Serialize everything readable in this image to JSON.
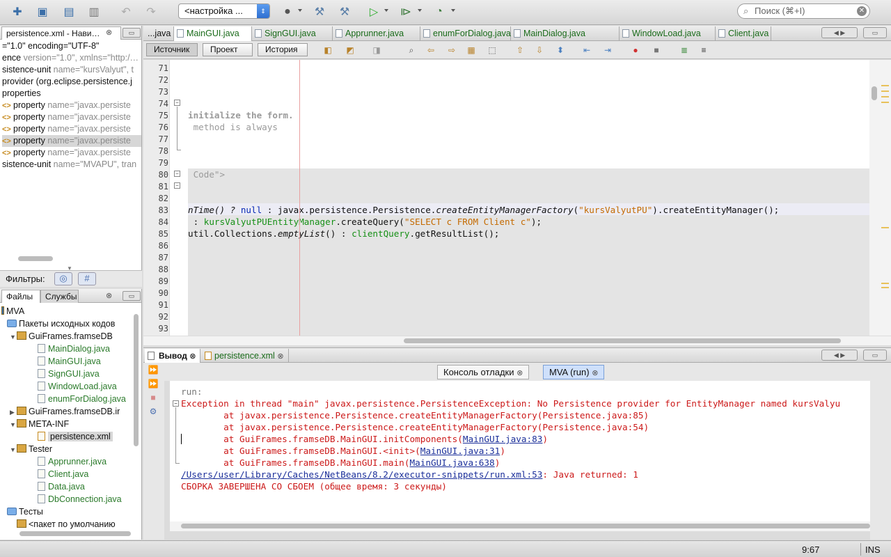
{
  "toolbar": {
    "config_value": "<настройка ...",
    "search_placeholder": "Поиск (⌘+I)",
    "icons": [
      "new-file-icon",
      "new-project-icon",
      "open-project-icon",
      "close-project-icon",
      "undo-icon",
      "redo-icon",
      "globe-icon",
      "build-icon",
      "clean-build-icon",
      "run-icon",
      "debug-icon",
      "profile-icon"
    ]
  },
  "nav": {
    "tab_label": "persistence.xml - Нави…",
    "lines": [
      {
        "text": "=\"1.0\" encoding=\"UTF-8\"",
        "attr": ""
      },
      {
        "text": "ence ",
        "attr": "version=\"1.0\", xmlns=\"http:/…"
      },
      {
        "text": "sistence-unit ",
        "attr": "name=\"kursValyut\", t"
      },
      {
        "text": "provider (org.eclipse.persistence.j",
        "attr": ""
      },
      {
        "text": "properties",
        "attr": ""
      },
      {
        "text": "property ",
        "attr": "name=\"javax.persiste"
      },
      {
        "text": "property ",
        "attr": "name=\"javax.persiste"
      },
      {
        "text": "property ",
        "attr": "name=\"javax.persiste"
      },
      {
        "text": "property ",
        "attr": "name=\"javax.persiste"
      },
      {
        "text": "property ",
        "attr": "name=\"javax.persiste"
      },
      {
        "text": "sistence-unit ",
        "attr": "name=\"MVAPU\", tran"
      }
    ],
    "filters_label": "Фильтры:"
  },
  "files": {
    "tabs": [
      "Файлы",
      "Службы"
    ],
    "tree": [
      {
        "label": "MVA",
        "indent": 0,
        "type": "project"
      },
      {
        "label": "Пакеты исходных кодов",
        "indent": 1,
        "type": "folder"
      },
      {
        "label": "GuiFrames.framseDB",
        "indent": 2,
        "type": "pkg"
      },
      {
        "label": "MainDialog.java",
        "indent": 3,
        "type": "java"
      },
      {
        "label": "MainGUI.java",
        "indent": 3,
        "type": "java"
      },
      {
        "label": "SignGUI.java",
        "indent": 3,
        "type": "java"
      },
      {
        "label": "WindowLoad.java",
        "indent": 3,
        "type": "java"
      },
      {
        "label": "enumForDialog.java",
        "indent": 3,
        "type": "java"
      },
      {
        "label": "GuiFrames.framseDB.ir",
        "indent": 2,
        "type": "pkg"
      },
      {
        "label": "META-INF",
        "indent": 2,
        "type": "pkg"
      },
      {
        "label": "persistence.xml",
        "indent": 3,
        "type": "xml"
      },
      {
        "label": "Tester",
        "indent": 2,
        "type": "pkg"
      },
      {
        "label": "Apprunner.java",
        "indent": 3,
        "type": "java"
      },
      {
        "label": "Client.java",
        "indent": 3,
        "type": "java"
      },
      {
        "label": "Data.java",
        "indent": 3,
        "type": "java"
      },
      {
        "label": "DbConnection.java",
        "indent": 3,
        "type": "java"
      },
      {
        "label": "Тесты",
        "indent": 1,
        "type": "folder"
      },
      {
        "label": "<пакет по умолчанию",
        "indent": 2,
        "type": "pkg"
      }
    ]
  },
  "editor": {
    "tabs": [
      "...java",
      "MainGUI.java",
      "SignGUI.java",
      "Apprunner.java",
      "enumForDialog.java",
      "MainDialog.java",
      "WindowLoad.java",
      "Client.java"
    ],
    "view_buttons": [
      "Источник",
      "Проект",
      "История"
    ],
    "line_numbers": [
      "71",
      "72",
      "73",
      "74",
      "75",
      "76",
      "77",
      "78",
      "79",
      "80",
      "81",
      "82",
      "83",
      "84",
      "85",
      "86",
      "87",
      "88",
      "89",
      "90",
      "91",
      "92",
      "93"
    ],
    "code": {
      "l75": "initialize the form.",
      "l76": " method is always",
      "l80": " Code\">",
      "l83_a": "nTime() ? ",
      "l83_kw": "null",
      "l83_b": " : javax.persistence.Persistence.",
      "l83_it": "createEntityManagerFactory",
      "l83_c": "(",
      "l83_str": "\"kursValyutPU\"",
      "l83_d": ").createEntityManager();",
      "l84_a": " : ",
      "l84_fld": "kursValyutPUEntityManager",
      "l84_b": ".createQuery(",
      "l84_str": "\"SELECT c FROM Client c\"",
      "l84_c": ");",
      "l85_a": "util.Collections.",
      "l85_it": "emptyList",
      "l85_b": "() : ",
      "l85_fld": "clientQuery",
      "l85_c": ".getResultList();"
    }
  },
  "output": {
    "tabs": [
      "Вывод",
      "persistence.xml"
    ],
    "subtabs": [
      "Консоль отладки",
      "MVA (run)"
    ],
    "lines": {
      "run": "run:",
      "exc": "Exception in thread \"main\" javax.persistence.PersistenceException: No Persistence provider for EntityManager named kursValyu",
      "at1": "        at javax.persistence.Persistence.createEntityManagerFactory(Persistence.java:85)",
      "at2": "        at javax.persistence.Persistence.createEntityManagerFactory(Persistence.java:54)",
      "at3_a": "        at GuiFrames.framseDB.MainGUI.initComponents(",
      "at3_link": "MainGUI.java:83",
      "at4_a": "        at GuiFrames.framseDB.MainGUI.<init>(",
      "at4_link": "MainGUI.java:31",
      "at5_a": "        at GuiFrames.framseDB.MainGUI.main(",
      "at5_link": "MainGUI.java:638",
      "close": ")",
      "path_link": "/Users/user/Library/Caches/NetBeans/8.2/executor-snippets/run.xml:53",
      "path_rest": ": Java returned: 1",
      "fail": "СБОРКА ЗАВЕРШЕНА СО СБОЕМ (общее время: 3 секунды)"
    }
  },
  "status": {
    "position": "9:67",
    "mode": "INS"
  },
  "colors": {
    "error_red": "#cc1a1a",
    "link_blue": "#1b2f9a",
    "active_subtab": "#cfe0fb",
    "file_green": "#2a7a2a"
  }
}
